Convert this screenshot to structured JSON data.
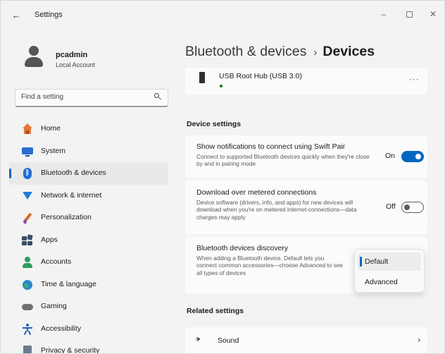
{
  "window": {
    "title": "Settings",
    "back_icon": "←",
    "minimize_icon": "–",
    "close_icon": "✕"
  },
  "profile": {
    "name": "pcadmin",
    "account_type": "Local Account"
  },
  "search": {
    "placeholder": "Find a setting",
    "value": ""
  },
  "sidebar": {
    "items": [
      {
        "label": "Home",
        "icon": "home-icon",
        "active": false
      },
      {
        "label": "System",
        "icon": "system-icon",
        "active": false
      },
      {
        "label": "Bluetooth & devices",
        "icon": "bluetooth-icon",
        "active": true
      },
      {
        "label": "Network & internet",
        "icon": "network-icon",
        "active": false
      },
      {
        "label": "Personalization",
        "icon": "personalization-icon",
        "active": false
      },
      {
        "label": "Apps",
        "icon": "apps-icon",
        "active": false
      },
      {
        "label": "Accounts",
        "icon": "accounts-icon",
        "active": false
      },
      {
        "label": "Time & language",
        "icon": "time-language-icon",
        "active": false
      },
      {
        "label": "Gaming",
        "icon": "gaming-icon",
        "active": false
      },
      {
        "label": "Accessibility",
        "icon": "accessibility-icon",
        "active": false
      },
      {
        "label": "Privacy & security",
        "icon": "privacy-icon",
        "active": false
      }
    ]
  },
  "breadcrumb": {
    "parent": "Bluetooth & devices",
    "separator": "›",
    "current": "Devices"
  },
  "device": {
    "name": "USB Root Hub (USB 3.0)",
    "more": "···"
  },
  "device_settings": {
    "title": "Device settings",
    "swift_pair": {
      "title": "Show notifications to connect using Swift Pair",
      "description": "Connect to supported Bluetooth devices quickly when they're close by and in pairing mode",
      "state_label": "On",
      "enabled": true
    },
    "metered": {
      "title": "Download over metered connections",
      "description": "Device software (drivers, info, and apps) for new devices will download when you're on metered internet connections—data charges may apply",
      "state_label": "Off",
      "enabled": false
    },
    "discovery": {
      "title": "Bluetooth devices discovery",
      "description": "When adding a Bluetooth device, Default lets you connect common accessories—choose Advanced to see all types of devices",
      "options": [
        "Default",
        "Advanced"
      ],
      "selected": "Default"
    }
  },
  "related": {
    "title": "Related settings",
    "sound_label": "Sound",
    "sound_icon": "🕩",
    "chevron": "›"
  },
  "colors": {
    "accent": "#0067c0",
    "background": "#f3f3f3",
    "card": "#fbfbfb"
  }
}
